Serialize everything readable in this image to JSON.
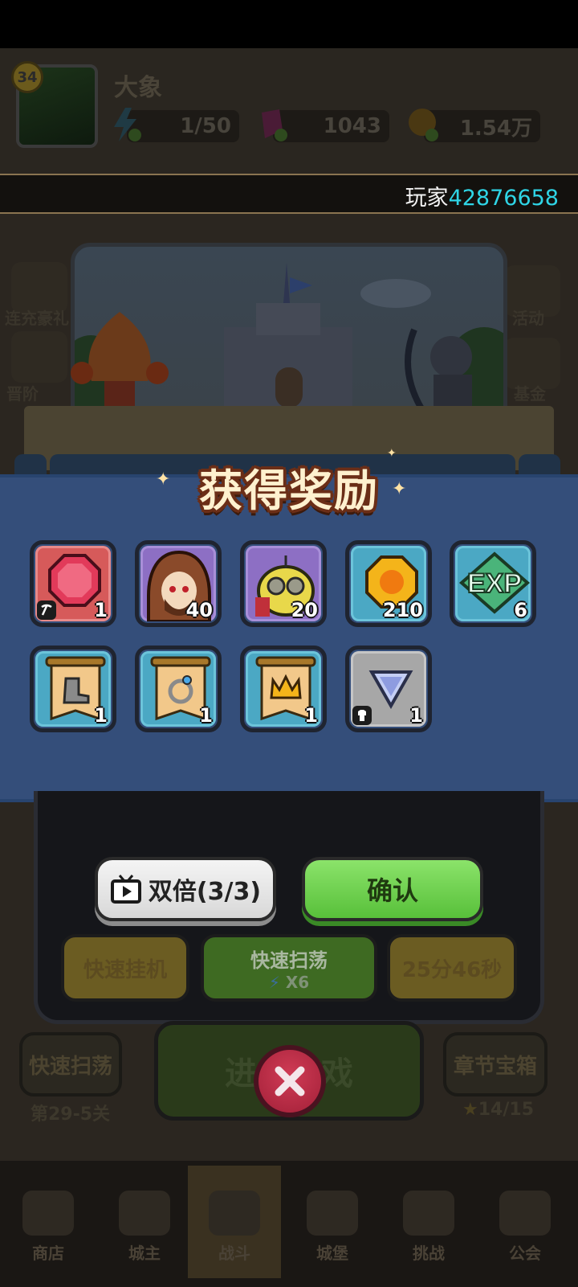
{
  "top": {
    "level": "34",
    "player_name": "大象",
    "energy": "1/50",
    "gems": "1043",
    "gold": "1.54万",
    "player_label": "玩家",
    "player_id": "42876658"
  },
  "side_left": [
    "连充豪礼",
    "晋阶"
  ],
  "side_right": [
    "活动",
    "基金"
  ],
  "modal": {
    "title": "获得奖励",
    "rewards": [
      {
        "icon": "ruby-gem-icon",
        "count": "1",
        "rarity": "red"
      },
      {
        "icon": "hooded-hero-portrait",
        "count": "40",
        "rarity": "purple"
      },
      {
        "icon": "goggles-goblin-portrait",
        "count": "20",
        "rarity": "purple"
      },
      {
        "icon": "gold-coin-icon",
        "count": "210",
        "rarity": "blue"
      },
      {
        "icon": "exp-icon",
        "label": "EXP",
        "count": "6",
        "rarity": "blue"
      },
      {
        "icon": "boot-scroll-icon",
        "count": "1",
        "rarity": "blue"
      },
      {
        "icon": "ring-scroll-icon",
        "count": "1",
        "rarity": "blue"
      },
      {
        "icon": "crown-scroll-icon",
        "count": "1",
        "rarity": "blue"
      },
      {
        "icon": "triangle-gem-icon",
        "count": "1",
        "rarity": "gray"
      }
    ]
  },
  "buttons": {
    "double": "双倍(3/3)",
    "confirm": "确认",
    "quick_idle": "快速挂机",
    "quick_sweep": "快速扫荡",
    "sweep_cost": "X6",
    "timer": "25分46秒",
    "enter_game": "进入游戏",
    "left_sweep": "快速扫荡",
    "left_stage": "第29-5关",
    "chapter_chest": "章节宝箱",
    "chapter_stars": "14/15"
  },
  "nav": [
    "商店",
    "城主",
    "战斗",
    "城堡",
    "挑战",
    "公会"
  ],
  "colors": {
    "accent_cyan": "#2fd5e6",
    "panel_blue": "#344e7a",
    "confirm_green": "#58c03a"
  }
}
